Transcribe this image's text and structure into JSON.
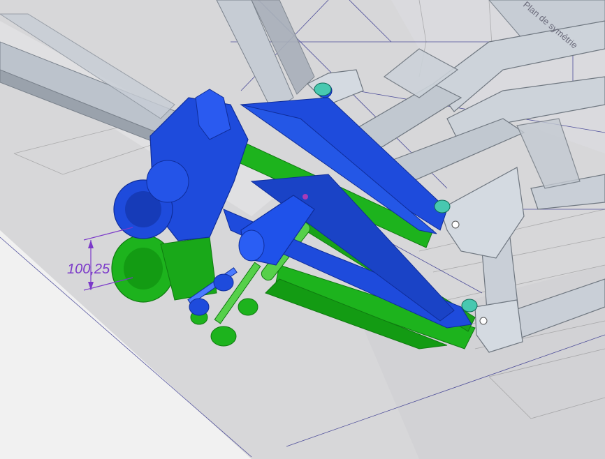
{
  "viewport": {
    "dimension_value": "100,25",
    "plane_label": "Plan de symétrie"
  },
  "colors": {
    "background": "#d9d9d9",
    "floor_light": "#ececec",
    "chassis_tube": "#c3cad3",
    "chassis_dark": "#8e96a0",
    "bracket": "#d2d8e0",
    "bracket_edge": "#6f7780",
    "blue_part": "#1e4bdc",
    "blue_shadow": "#1231a8",
    "green_part": "#1db31d",
    "green_shadow": "#0f8a12",
    "dimension": "#7b39c9",
    "construction_line": "#2a2a8a"
  },
  "icons": [
    "dimension-arrow-icon"
  ]
}
